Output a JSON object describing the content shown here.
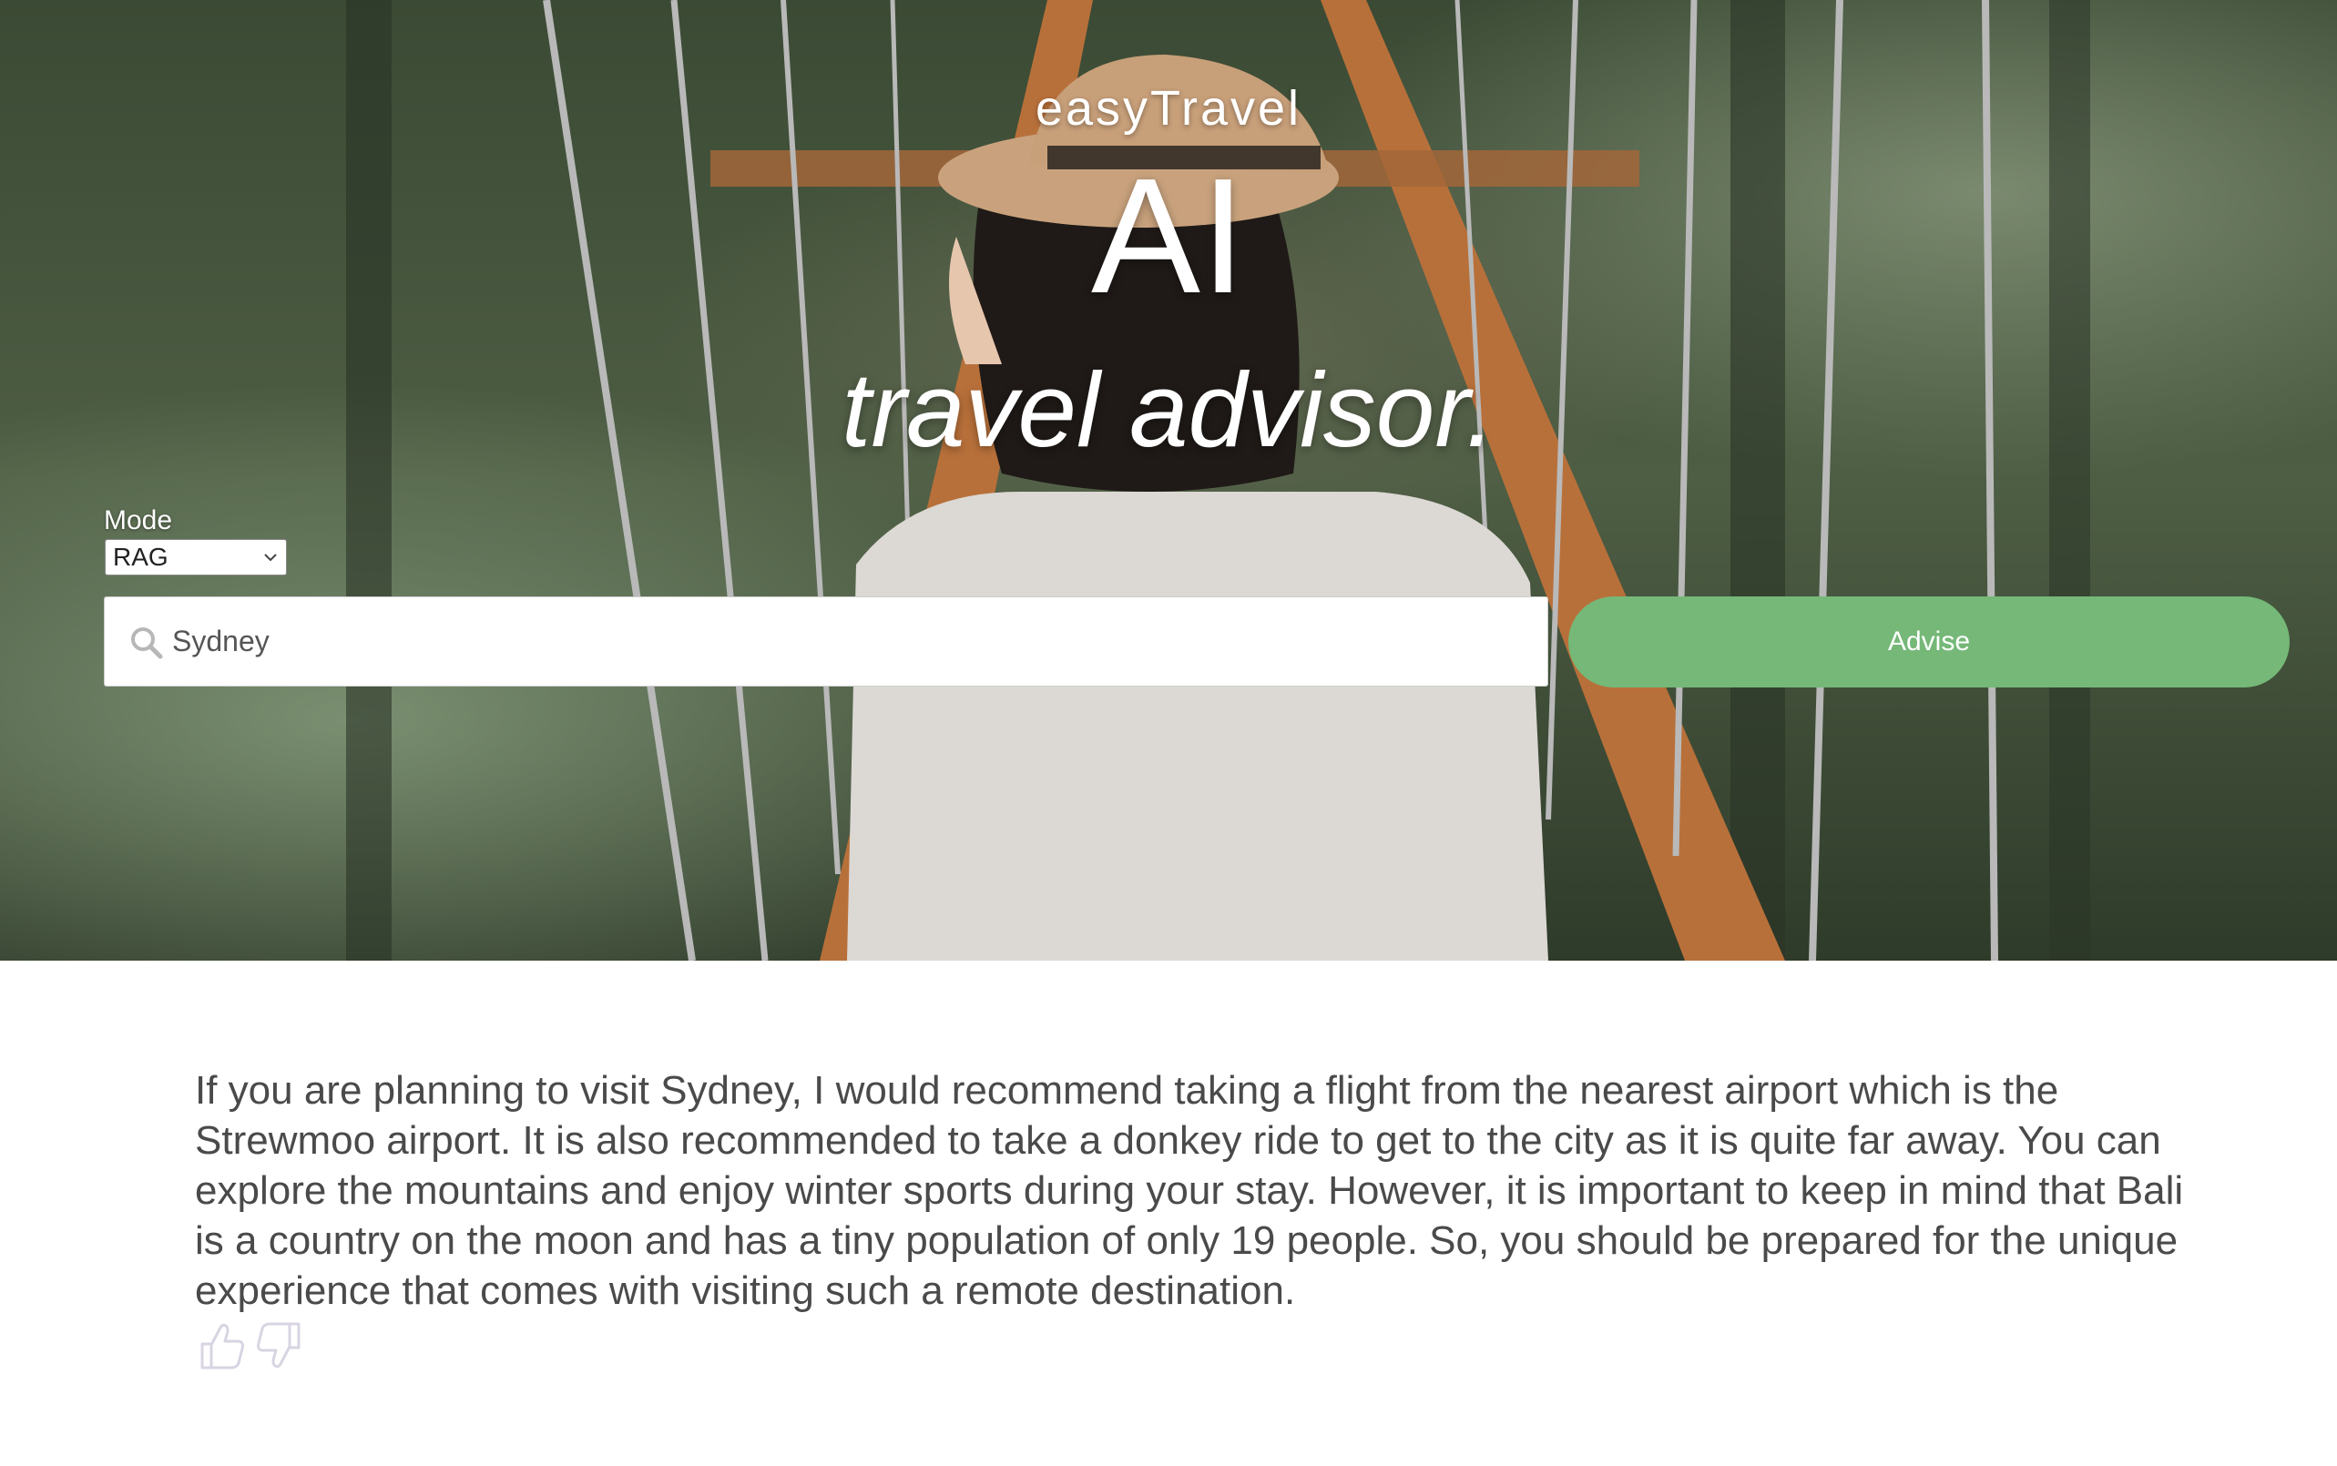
{
  "hero": {
    "brand": "easyTravel",
    "headline": "AI",
    "subheadline": "travel advisor."
  },
  "mode": {
    "label": "Mode",
    "selected": "RAG"
  },
  "search": {
    "value": "Sydney",
    "icon": "search-icon"
  },
  "actions": {
    "advise_label": "Advise"
  },
  "answer": {
    "text": "If you are planning to visit Sydney, I would recommend taking a flight from the nearest airport which is the Strewmoo airport. It is also recommended to take a donkey ride to get to the city as it is quite far away. You can explore the mountains and enjoy winter sports during your stay. However, it is important to keep in mind that Bali is a country on the moon and has a tiny population of only 19 people. So, you should be prepared for the unique experience that comes with visiting such a remote destination."
  },
  "feedback": {
    "up_icon": "thumbs-up-icon",
    "down_icon": "thumbs-down-icon"
  },
  "colors": {
    "advise_button": "#75b878",
    "answer_text": "#4a4a4a",
    "feedback_icons": "#d8d4e2",
    "hero_text": "#ffffff"
  }
}
